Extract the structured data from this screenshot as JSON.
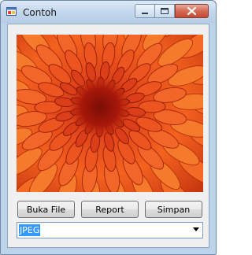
{
  "window": {
    "title": "Contoh"
  },
  "buttons": {
    "open": "Buka File",
    "report": "Report",
    "save": "Simpan"
  },
  "format_select": {
    "value": "JPEG"
  },
  "image": {
    "subject": "orange chrysanthemum flower"
  },
  "colors": {
    "titlebar": "#c3d7ed",
    "close_button": "#d46a55",
    "selection": "#3399ff"
  }
}
